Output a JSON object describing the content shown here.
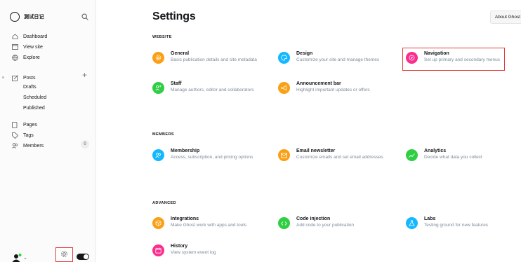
{
  "brand": {
    "name": "测试日记"
  },
  "sidebar": {
    "items": [
      {
        "label": "Dashboard",
        "icon": "home-icon"
      },
      {
        "label": "View site",
        "icon": "browser-icon"
      },
      {
        "label": "Explore",
        "icon": "globe-icon"
      },
      {
        "label": "Posts",
        "icon": "edit-icon"
      },
      {
        "label": "Pages",
        "icon": "page-icon"
      },
      {
        "label": "Tags",
        "icon": "tag-icon"
      },
      {
        "label": "Members",
        "icon": "members-icon"
      }
    ],
    "post_subitems": [
      "Drafts",
      "Scheduled",
      "Published"
    ],
    "members_count": "0",
    "posts_add": "+"
  },
  "header": {
    "title": "Settings",
    "about_button": "About Ghost"
  },
  "sections": [
    {
      "label": "WEBSITE",
      "cards": [
        {
          "title": "General",
          "desc": "Basic publication details and site metadata",
          "color": "#fb9f14",
          "icon": "gear-icon"
        },
        {
          "title": "Design",
          "desc": "Customize your site and manage themes",
          "color": "#14b8ff",
          "icon": "palette-icon"
        },
        {
          "title": "Navigation",
          "desc": "Set up primary and secondary menus",
          "color": "#fb2d8d",
          "icon": "compass-icon"
        },
        {
          "title": "Staff",
          "desc": "Manage authors, editor and collaborators",
          "color": "#30cf43",
          "icon": "staff-icon"
        },
        {
          "title": "Announcement bar",
          "desc": "Highlight important updates or offers",
          "color": "#fb9f14",
          "icon": "megaphone-icon"
        }
      ]
    },
    {
      "label": "MEMBERS",
      "cards": [
        {
          "title": "Membership",
          "desc": "Access, subscription, and pricing options",
          "color": "#14b8ff",
          "icon": "membership-icon"
        },
        {
          "title": "Email newsletter",
          "desc": "Customize emails and set email addresses",
          "color": "#fb9f14",
          "icon": "email-icon"
        },
        {
          "title": "Analytics",
          "desc": "Decide what data you collect",
          "color": "#30cf43",
          "icon": "analytics-icon"
        }
      ]
    },
    {
      "label": "ADVANCED",
      "cards": [
        {
          "title": "Integrations",
          "desc": "Make Ghost work with apps and tools",
          "color": "#fb9f14",
          "icon": "integrations-icon"
        },
        {
          "title": "Code injection",
          "desc": "Add code to your publication",
          "color": "#30cf43",
          "icon": "code-icon"
        },
        {
          "title": "Labs",
          "desc": "Testing ground for new features",
          "color": "#14b8ff",
          "icon": "labs-icon"
        },
        {
          "title": "History",
          "desc": "View system event log",
          "color": "#fb2d8d",
          "icon": "history-icon"
        }
      ]
    }
  ]
}
